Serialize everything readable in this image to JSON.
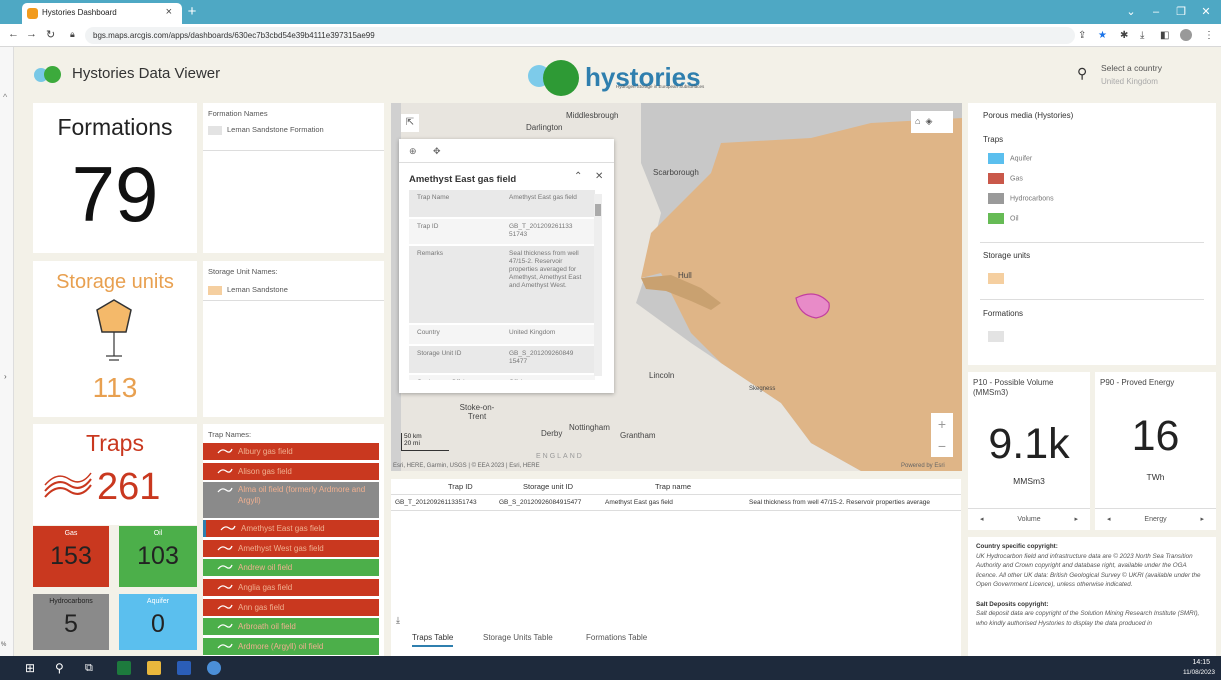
{
  "browser": {
    "tab_title": "Hystories Dashboard",
    "url": "bgs.maps.arcgis.com/apps/dashboards/630ec7b3cbd54e39b4111e397315ae99"
  },
  "header": {
    "app_title": "Hystories Data Viewer",
    "brand": "hystories",
    "brand_sub": "Hydrogen Storage in European Subsurfaces",
    "country_label": "Select a country",
    "country_value": "United Kingdom"
  },
  "stats": {
    "formations_title": "Formations",
    "formations_value": "79",
    "storage_title": "Storage units",
    "storage_value": "113",
    "traps_title": "Traps",
    "traps_value": "261",
    "tiles": [
      {
        "label": "Gas",
        "value": "153",
        "color": "#c9381f"
      },
      {
        "label": "Oil",
        "value": "103",
        "color": "#4caf4a"
      },
      {
        "label": "Hydrocarbons",
        "value": "5",
        "color": "#8a8a8a"
      },
      {
        "label": "Aquifer",
        "value": "0",
        "color": "#5bbfee"
      }
    ]
  },
  "formation_list": {
    "header": "Formation Names",
    "items": [
      "Leman Sandstone Formation"
    ]
  },
  "storage_list": {
    "header": "Storage Unit Names:",
    "items": [
      "Leman Sandstone"
    ]
  },
  "trap_list": {
    "header": "Trap Names:",
    "items": [
      {
        "name": "Albury gas field",
        "color": "#c9381f"
      },
      {
        "name": "Alison gas field",
        "color": "#c9381f"
      },
      {
        "name": "Alma oil field (formerly Ardmore and Argyll)",
        "color": "#8a8a8a"
      },
      {
        "name": "Amethyst East gas field",
        "color": "#c9381f"
      },
      {
        "name": "Amethyst West gas field",
        "color": "#c9381f"
      },
      {
        "name": "Andrew oil field",
        "color": "#4caf4a"
      },
      {
        "name": "Anglia gas field",
        "color": "#c9381f"
      },
      {
        "name": "Ann gas field",
        "color": "#c9381f"
      },
      {
        "name": "Arbroath oil field",
        "color": "#4caf4a"
      },
      {
        "name": "Ardmore (Argyll) oil field",
        "color": "#4caf4a"
      }
    ]
  },
  "map": {
    "places": [
      "Middlesbrough",
      "Darlington",
      "Scarborough",
      "Hull",
      "Lincoln",
      "Skegness",
      "Stoke-on-Trent",
      "Derby",
      "Nottingham",
      "Grantham",
      "ENGLAND"
    ],
    "scale_km": "50 km",
    "scale_mi": "20 mi",
    "attribution": "Esri, HERE, Garmin, USGS | © EEA 2023 | Esri, HERE",
    "powered": "Powered by Esri"
  },
  "popup": {
    "title": "Amethyst East gas field",
    "rows": [
      {
        "k": "Trap Name",
        "v": "Amethyst East gas field"
      },
      {
        "k": "Trap ID",
        "v": "GB_T_201209261133 51743"
      },
      {
        "k": "Remarks",
        "v": "Seal thickness from well 47/15-2. Reservoir properties averaged for Amethyst, Amethyst East and Amethyst West."
      },
      {
        "k": "Country",
        "v": "United Kingdom"
      },
      {
        "k": "Storage Unit ID",
        "v": "GB_S_201209260849 15477"
      },
      {
        "k": "Onshore or Offshore",
        "v": "Offshore"
      }
    ]
  },
  "table": {
    "headers": [
      "Trap ID",
      "Storage unit ID",
      "Trap name"
    ],
    "row": [
      "GB_T_20120926113351743",
      "GB_S_20120926084915477",
      "Amethyst East gas field",
      "Seal thickness from well 47/15-2. Reservoir properties average"
    ],
    "tabs": [
      "Traps Table",
      "Storage Units Table",
      "Formations Table"
    ]
  },
  "legend": {
    "title": "Porous media (Hystories)",
    "traps_header": "Traps",
    "traps": [
      {
        "label": "Aquifer",
        "color": "#5bbfee"
      },
      {
        "label": "Gas",
        "color": "#c9584a"
      },
      {
        "label": "Hydrocarbons",
        "color": "#9a9a9a"
      },
      {
        "label": "Oil",
        "color": "#66bb55"
      }
    ],
    "storage_header": "Storage units",
    "storage_color": "#f5cfa0",
    "formations_header": "Formations",
    "formations_color": "#e3e3e3"
  },
  "metrics": [
    {
      "title": "P10 - Possible Volume (MMSm3)",
      "value": "9.1k",
      "unit": "MMSm3",
      "footer": "Volume"
    },
    {
      "title": "P90 - Proved Energy",
      "value": "16",
      "unit": "TWh",
      "footer": "Energy"
    }
  ],
  "copyright": {
    "h1": "Country specific copyright:",
    "t1": "UK Hydrocarbon field and infrastructure data are © 2023 North Sea Transition Authority and Crown copyright and database right, available under the OGA licence. All other UK data: British Geological Survey © UKRI (available under the Open Government Licence), unless otherwise indicated.",
    "h2": "Salt Deposits copyright:",
    "t2": "Salt deposit data are copyright of the Solution Mining Research Institute (SMRI), who kindly authorised Hystories to display the data produced in"
  },
  "taskbar": {
    "time": "14:15",
    "date": "11/08/2023"
  },
  "misc": {
    "zoom_pct": "%"
  }
}
